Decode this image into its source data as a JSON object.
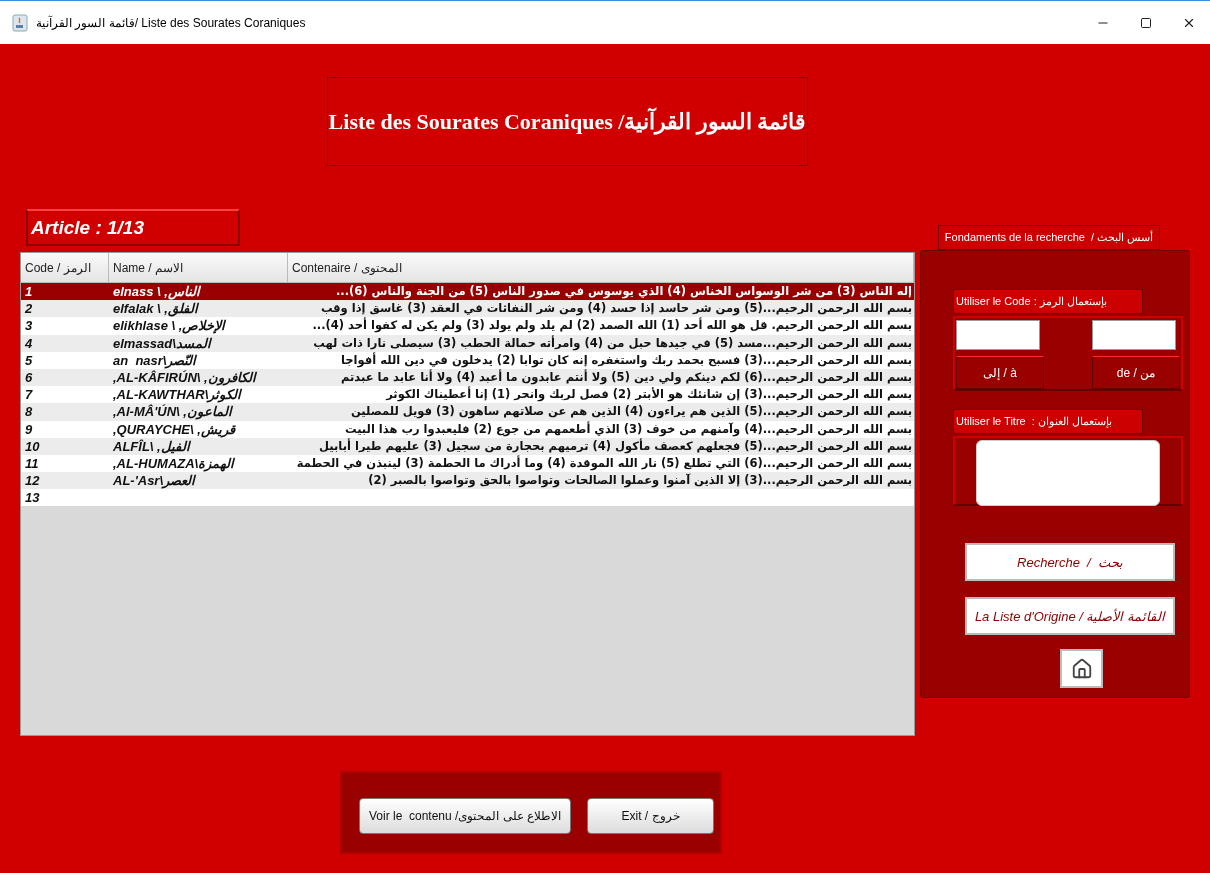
{
  "window": {
    "title": "قائمة السور القرآنية/ Liste des Sourates Coraniques"
  },
  "header": {
    "title": "Liste des Sourates Coraniques /قائمة السور القرآنية"
  },
  "article": "Article : 1/13",
  "table": {
    "headers": {
      "code": "Code / الرمز",
      "name": "Name / الاسم",
      "content": "Contenaire / المحتوى"
    },
    "rows": [
      {
        "code": "1",
        "name": "elnass \\ ,الناس",
        "content": "إله الناس (3) من شر الوسواس الخناس (4) الذي يوسوس في صدور الناس (5) من الجنة والناس (6)...",
        "selected": true
      },
      {
        "code": "2",
        "name": "elfalak \\ ,الفلق",
        "content": "بسم الله الرحمن الرحيم...(5) ومن شر حاسد إذا حسد (4) ومن شر النفاثات في العقد (3) غاسق إذا وقب",
        "selected": false
      },
      {
        "code": "3",
        "name": "elikhlase \\ ,الإخلاص",
        "content": "بسم الله الرحمن الرحيم. قل هو الله أحد (1) الله الصمد (2) لم يلد ولم يولد (3) ولم يكن له كفوا أحد (4)...",
        "selected": false
      },
      {
        "code": "4",
        "name": "elmassad\\المسد",
        "content": "بسم الله الرحمن الرحيم...مسد (5) في جيدها حبل من (4) وامرأته حمالة الحطب (3) سيصلى نارا ذات لهب",
        "selected": false
      },
      {
        "code": "5",
        "name": "an  nasr\\النّصر",
        "content": "بسم الله الرحمن الرحيم...(3) فسبح بحمد ربك واستغفره إنه كان توابا (2) يدخلون في دين الله أفواجا",
        "selected": false
      },
      {
        "code": "6",
        "name": ",AL-KÂFIRÚN\\ ,الكافرون",
        "content": "بسم الله الرحمن الرحيم...(6) لكم دينكم ولي دين (5) ولا أنتم عابدون ما أعبد (4) ولا أنا عابد ما عبدتم",
        "selected": false
      },
      {
        "code": "7",
        "name": ",AL-KAWTHAR\\الكوثر",
        "content": "بسم الله الرحمن الرحيم...(3) إن شانئك هو الأبتر (2) فصل لربك وانحر (1) إنا أعطيناك الكوثر",
        "selected": false
      },
      {
        "code": "8",
        "name": ",Al-MÂ'ÚN\\ ,الماعون",
        "content": "بسم الله الرحمن الرحيم...(5) الذين هم يراءون (4) الذين هم عن صلاتهم ساهون (3) فويل للمصلين",
        "selected": false
      },
      {
        "code": "9",
        "name": ",QURAYCHE\\ ,قريش",
        "content": "بسم الله الرحمن الرحيم...(4) وآمنهم من خوف (3) الذي أطعمهم من جوع (2) فليعبدوا رب هذا البيت",
        "selected": false
      },
      {
        "code": "10",
        "name": "ALFÎL\\ ,الفيل",
        "content": "بسم الله الرحمن الرحيم...(5) فجعلهم كعصف مأكول (4) ترميهم بحجارة من سجيل (3) عليهم طيرا أبابيل",
        "selected": false
      },
      {
        "code": "11",
        "name": ",AL-HUMAZA\\الهمزة",
        "content": "بسم الله الرحمن الرحيم...(6) التي تطلع (5) نار الله الموقدة (4) وما أدراك ما الحطمة (3) لينبذن في الحطمة",
        "selected": false
      },
      {
        "code": "12",
        "name": "AL-'Asr\\العصر",
        "content": "بسم الله الرحمن الرحيم...(3) إلا الذين آمنوا وعملوا الصالحات وتواصوا بالحق وتواصوا بالصبر (2)",
        "selected": false
      },
      {
        "code": "13",
        "selected": false
      }
    ]
  },
  "search": {
    "title": "Fondaments de la recherche  / أسس البحث",
    "code_label": "Utiliser le Code : بإستعمال الرمز",
    "to_label": "إلى / à",
    "from_label": "de / من",
    "title_label": "Utiliser le Titre  : بإستعمال العنوان",
    "search_button": "Recherche  /  بحث",
    "origin_button": "La Liste d'Origine / القائمة الأصلية"
  },
  "footer": {
    "view_button": "Voir le  contenu /الاطلاع على المحتوى",
    "exit_button": "Exit / خروج"
  }
}
